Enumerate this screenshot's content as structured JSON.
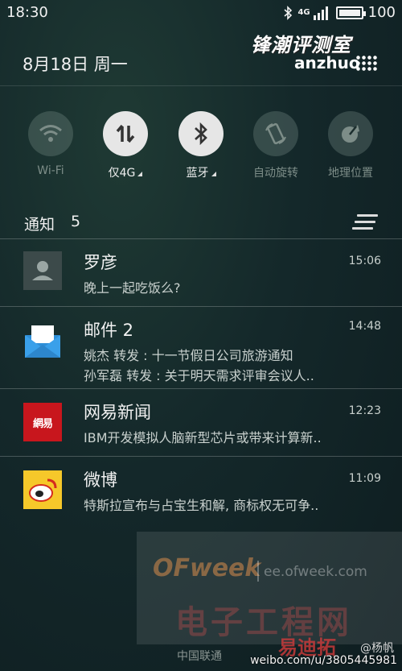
{
  "status_bar": {
    "time": "18:30",
    "network": "4G",
    "battery": "100",
    "icons": [
      "bluetooth-icon",
      "signal-icon",
      "battery-icon"
    ]
  },
  "watermark_top": {
    "cn": "锋潮评测室",
    "en": "anzhuo"
  },
  "date": "8月18日 周一",
  "quick_toggles": [
    {
      "label": "Wi-Fi",
      "icon": "wifi-icon",
      "active": false
    },
    {
      "label": "仅4G",
      "icon": "data-arrows-icon",
      "active": true
    },
    {
      "label": "蓝牙",
      "icon": "bluetooth-icon",
      "active": true
    },
    {
      "label": "自动旋转",
      "icon": "rotate-icon",
      "active": false
    },
    {
      "label": "地理位置",
      "icon": "location-icon",
      "active": false
    }
  ],
  "notifications_header": {
    "title": "通知",
    "count": "5"
  },
  "notifications": [
    {
      "app": "contact",
      "title": "罗彦",
      "time": "15:06",
      "lines": [
        "晚上一起吃饭么?"
      ]
    },
    {
      "app": "mail",
      "title": "邮件 2",
      "time": "14:48",
      "lines": [
        "姚杰  转发 : 十一节假日公司旅游通知",
        "孙军磊  转发 : 关于明天需求评审会议人.."
      ]
    },
    {
      "app": "netease",
      "title": "网易新闻",
      "time": "12:23",
      "icon_text": "網易",
      "lines": [
        "IBM开发模拟人脑新型芯片或带来计算新.."
      ]
    },
    {
      "app": "weibo",
      "title": "微博",
      "time": "11:09",
      "lines": [
        "特斯拉宣布与占宝生和解, 商标权无可争.."
      ]
    }
  ],
  "watermark_bottom": {
    "brand": "OFweek",
    "url": "ee.ofweek.com",
    "cn": "电子工程网",
    "carrier": "中国联通",
    "yi": "易迪拓",
    "at": "@杨帆",
    "weibo": "weibo.com/u/3805445981"
  },
  "colors": {
    "toggle_on": "#e6e6e6",
    "mail_blue": "#2f8fd8",
    "netease_red": "#c8161d",
    "weibo_yellow": "#f6c82a"
  }
}
